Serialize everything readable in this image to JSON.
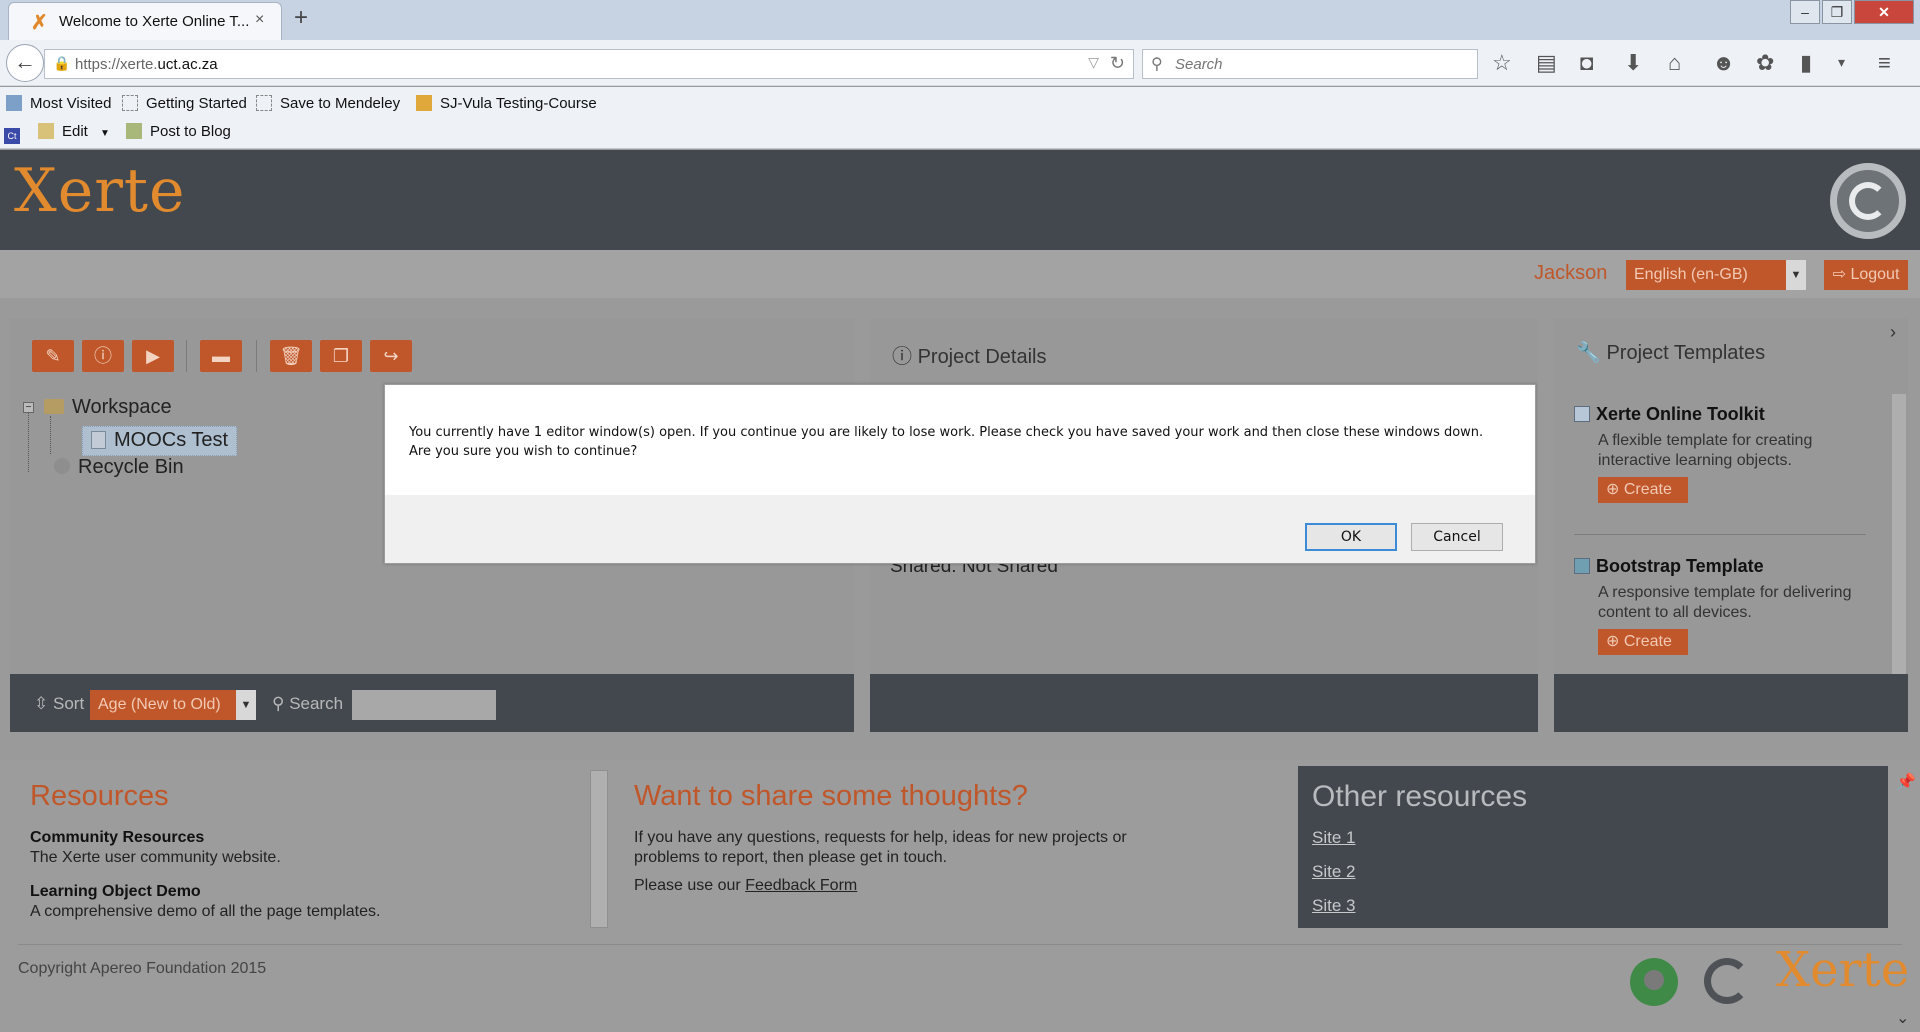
{
  "browser": {
    "tab_title": "Welcome to Xerte Online T...",
    "tab_close": "×",
    "new_tab": "+",
    "url_prefix": "https://xerte.",
    "url_host": "uct.ac.za",
    "search_placeholder": "Search",
    "bookmarks": [
      {
        "label": "Most Visited"
      },
      {
        "label": "Getting Started"
      },
      {
        "label": "Save to Mendeley"
      },
      {
        "label": "SJ-Vula Testing-Course"
      }
    ],
    "bookmarks_row2": [
      {
        "label": "Ct"
      },
      {
        "label": "Edit"
      },
      {
        "label": "Post to Blog"
      }
    ]
  },
  "app": {
    "logo_text": "Xerte",
    "user": "Jackson",
    "language": "English (en-GB)",
    "logout": "Logout"
  },
  "workspace": {
    "tree": {
      "workspace": "Workspace",
      "project": "MOOCs Test",
      "recycle": "Recycle Bin"
    },
    "sort_label": "Sort",
    "sort_value": "Age (New to Old)",
    "search_label": "Search"
  },
  "project_details": {
    "heading": "Project Details",
    "shared": "Shared: Not Shared"
  },
  "templates": {
    "heading": "Project Templates",
    "items": [
      {
        "title": "Xerte Online Toolkit",
        "desc": "A flexible template for creating interactive learning objects.",
        "button": "Create"
      },
      {
        "title": "Bootstrap Template",
        "desc": "A responsive template for delivering content to all devices.",
        "button": "Create"
      }
    ]
  },
  "resources": {
    "heading": "Resources",
    "items": [
      {
        "title": "Community Resources",
        "desc": "The Xerte user community website."
      },
      {
        "title": "Learning Object Demo",
        "desc": "A comprehensive demo of all the page templates."
      }
    ]
  },
  "feedback": {
    "heading": "Want to share some thoughts?",
    "line1": "If you have any questions, requests for help, ideas for new projects or",
    "line2": "problems to report, then please get in touch.",
    "line3": "Please use our ",
    "link": "Feedback Form"
  },
  "other_resources": {
    "heading": "Other resources",
    "links": [
      "Site 1",
      "Site 2",
      "Site 3"
    ]
  },
  "footer": {
    "copyright": "Copyright Apereo Foundation 2015",
    "logo_text": "Xerte"
  },
  "dialog": {
    "message": "You currently have 1 editor window(s) open. If you continue you are likely to lose work. Please check you have saved your work and then close these windows down. Are you sure you wish to continue?",
    "ok": "OK",
    "cancel": "Cancel"
  },
  "colors": {
    "accent": "#c0572a",
    "header": "#43484e",
    "logo": "#e28a2e"
  }
}
